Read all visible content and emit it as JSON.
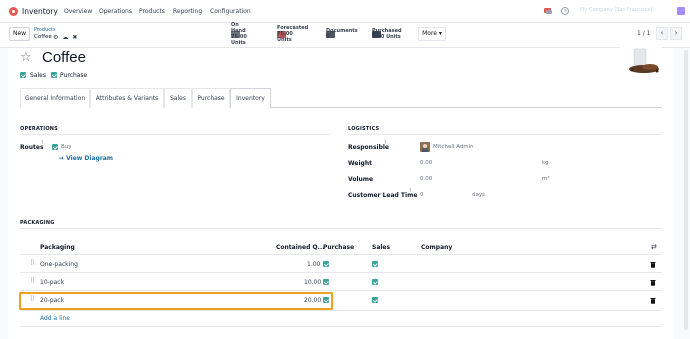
{
  "topbar": {
    "app_name": "Inventory",
    "menu": [
      "Overview",
      "Operations",
      "Products",
      "Reporting",
      "Configuration"
    ],
    "user": "My Company (San Francisco)"
  },
  "control_panel": {
    "new_label": "New",
    "breadcrumb_parent": "Products",
    "breadcrumb_current": "Coffee",
    "smart_buttons": [
      {
        "label": "On Hand",
        "value": "75.00 Units"
      },
      {
        "label": "Forecasted",
        "value": "75.00 Units"
      },
      {
        "label": "Documents",
        "value": "0"
      },
      {
        "label": "Purchased",
        "value": "0.00 Units"
      }
    ],
    "more_label": "More",
    "pager": "1 / 1"
  },
  "product": {
    "name": "Coffee",
    "sales_label": "Sales",
    "purchase_label": "Purchase"
  },
  "tabs": [
    "General Information",
    "Attributes & Variants",
    "Sales",
    "Purchase",
    "Inventory"
  ],
  "operations": {
    "title": "OPERATIONS",
    "routes_label": "Routes",
    "routes_help": "?",
    "route_value": "Buy",
    "view_diagram": "View Diagram"
  },
  "logistics": {
    "title": "LOGISTICS",
    "responsible_label": "Responsible",
    "responsible_help": "?",
    "responsible_value": "Mitchell Admin",
    "weight_label": "Weight",
    "weight_value": "0.00",
    "weight_unit": "kg",
    "volume_label": "Volume",
    "volume_value": "0.00",
    "volume_unit": "m³",
    "lead_label": "Customer Lead Time",
    "lead_help": "?",
    "lead_value": "0",
    "lead_unit": "days"
  },
  "packaging": {
    "title": "PACKAGING",
    "headers": [
      "Packaging",
      "Contained Q...",
      "Purchase",
      "Sales",
      "Company"
    ],
    "rows": [
      {
        "name": "One-packing",
        "qty": "1.00"
      },
      {
        "name": "10-pack",
        "qty": "10.00"
      },
      {
        "name": "20-pack",
        "qty": "20.00"
      }
    ],
    "add_line": "Add a line"
  },
  "colors": {
    "accent": "#3aa49b",
    "link": "#1e6fa8",
    "highlight": "#f0a020",
    "logo": "#e45b55"
  }
}
